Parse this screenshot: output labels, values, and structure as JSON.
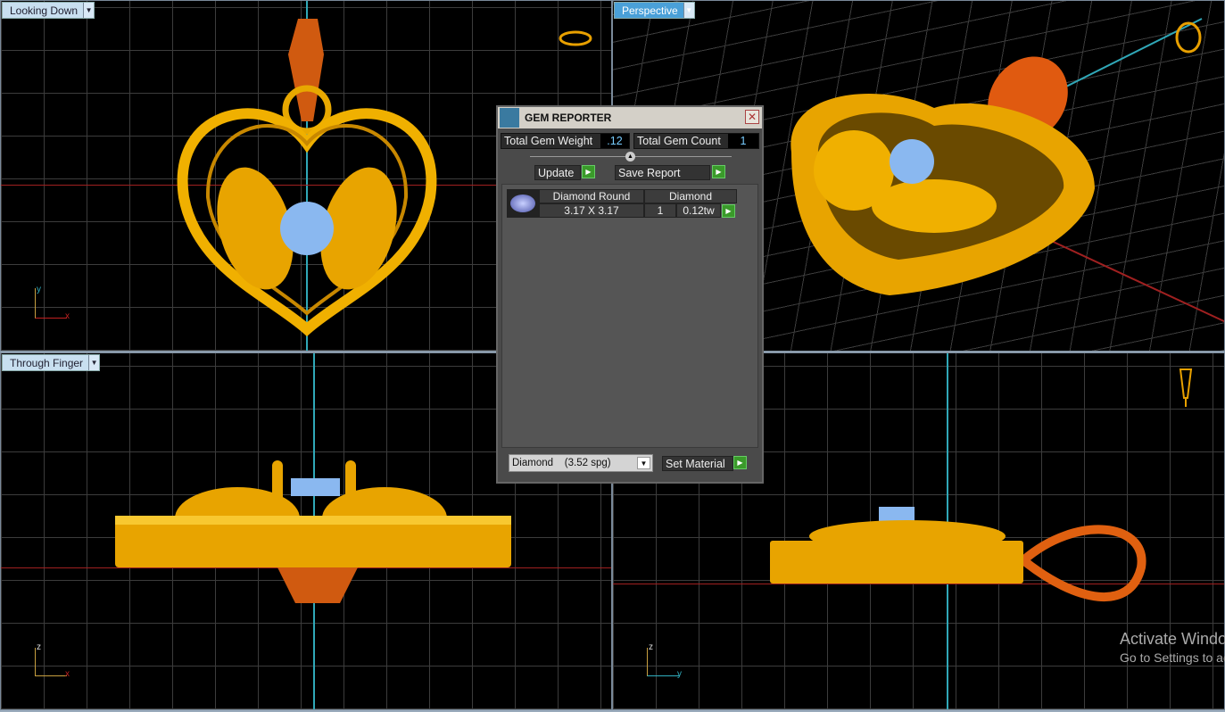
{
  "viewports": [
    {
      "label": "Looking Down",
      "axes": [
        "y",
        "x"
      ]
    },
    {
      "label": "Perspective"
    },
    {
      "label": "Through Finger",
      "axes": [
        "z",
        "x"
      ]
    },
    {
      "label": "",
      "axes": [
        "z",
        "y"
      ]
    }
  ],
  "dialog": {
    "title": "GEM REPORTER",
    "total_weight_label": "Total Gem Weight",
    "total_weight": ".12",
    "total_count_label": "Total Gem Count",
    "total_count": "1",
    "update_label": "Update",
    "save_label": "Save Report",
    "gems": [
      {
        "shape": "Diamond Round",
        "material": "Diamond",
        "size": "3.17 X 3.17",
        "count": "1",
        "weight": "0.12tw"
      }
    ],
    "material_select": "Diamond    (3.52 spg)",
    "set_material_label": "Set Material"
  },
  "watermark": {
    "line1": "Activate Windows",
    "line2": "Go to Settings to activate Windows."
  },
  "colors": {
    "gold": "#e8a800",
    "gem": "#8ab8f0",
    "axis_x": "#c02020",
    "axis_y": "#30b0c0"
  }
}
